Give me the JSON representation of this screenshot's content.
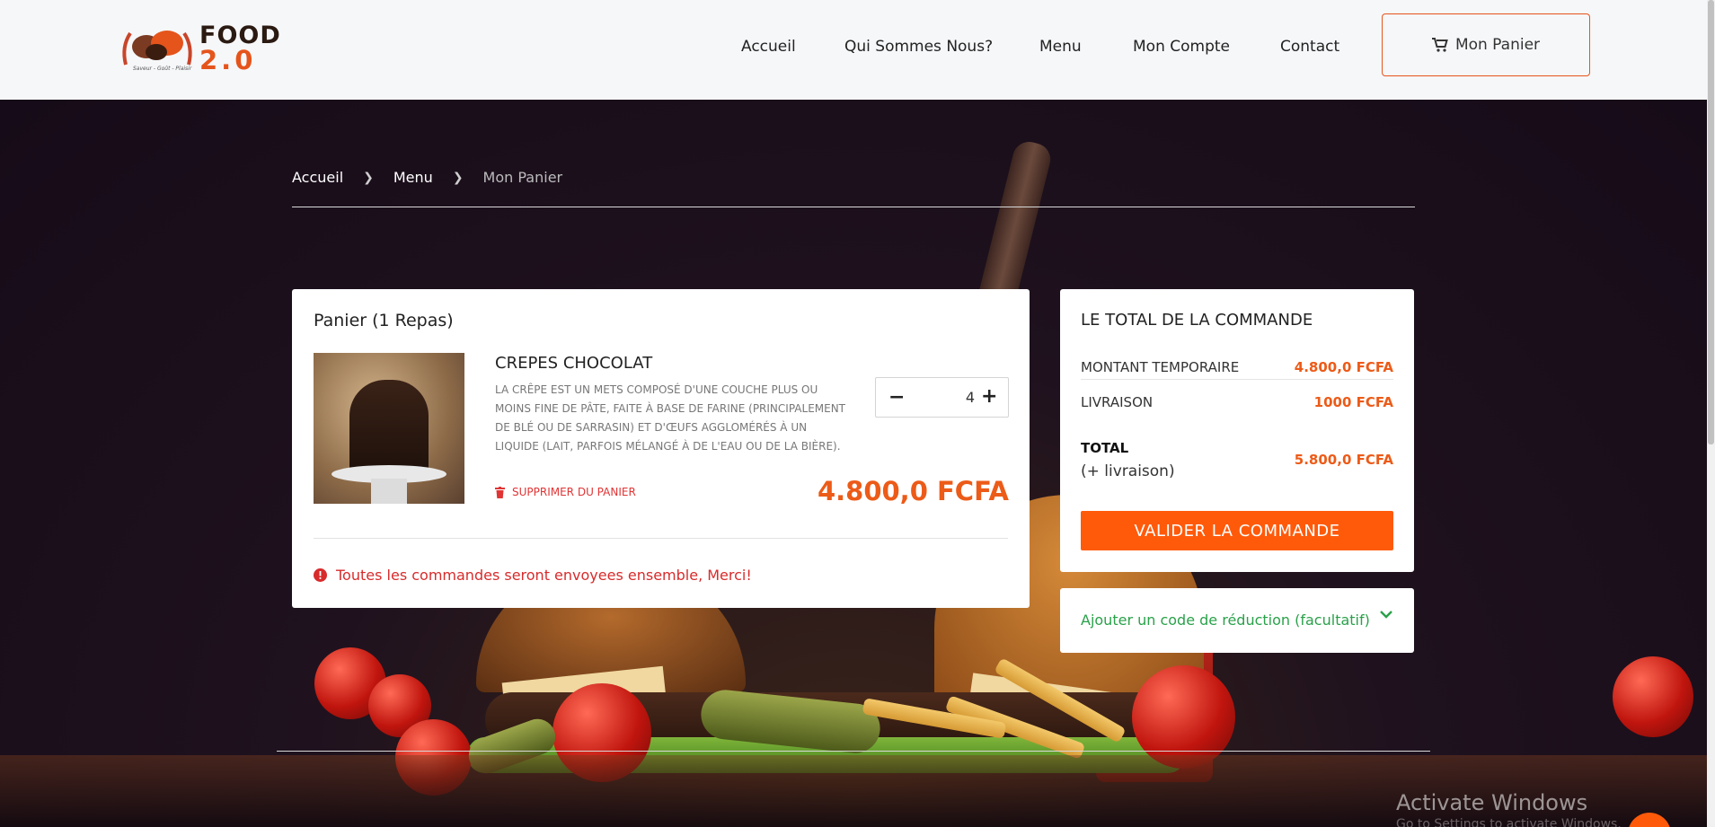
{
  "brand": {
    "name_top": "FOOD",
    "name_bottom": "2.0",
    "tagline": "Saveur - Goût - Plaisir"
  },
  "nav": {
    "items": [
      {
        "label": "Accueil"
      },
      {
        "label": "Qui Sommes Nous?"
      },
      {
        "label": "Menu"
      },
      {
        "label": "Mon Compte"
      },
      {
        "label": "Contact"
      }
    ],
    "cart_label": "Mon Panier"
  },
  "breadcrumb": {
    "items": [
      "Accueil",
      "Menu"
    ],
    "current": "Mon Panier"
  },
  "cart": {
    "title": "Panier (1 Repas)",
    "item": {
      "name": "CREPES CHOCOLAT",
      "description": "La crêpe est un mets composé d'une couche plus ou moins fine de pâte, faite à base de farine (principalement de blé ou de sarrasin) et d'œufs agglomérés à un liquide (lait, parfois mélangé à de l'eau ou de la bière).",
      "remove_label": "Supprimer du panier",
      "quantity": "4",
      "price": "4.800,0 FCFA"
    },
    "notice": "Toutes les commandes seront envoyees ensemble, Merci!"
  },
  "summary": {
    "title": "Le total de la commande",
    "subtotal_label": "MONTANT TEMPORAIRE",
    "subtotal_value": "4.800,0 FCFA",
    "delivery_label": "LIVRAISON",
    "delivery_value": "1000 FCFA",
    "total_label": "TOTAL",
    "total_sub": "(+ livraison)",
    "total_value": "5.800,0 FCFA",
    "validate_label": "Valider la commande"
  },
  "promo": {
    "label": "Ajouter un code de réduction (facultatif)"
  },
  "os_watermark": {
    "title": "Activate Windows",
    "subtitle": "Go to Settings to activate Windows."
  },
  "colors": {
    "accent": "#ec5b18",
    "button": "#ff5a0a",
    "success": "#2aa14a",
    "danger": "#d82b2b"
  }
}
